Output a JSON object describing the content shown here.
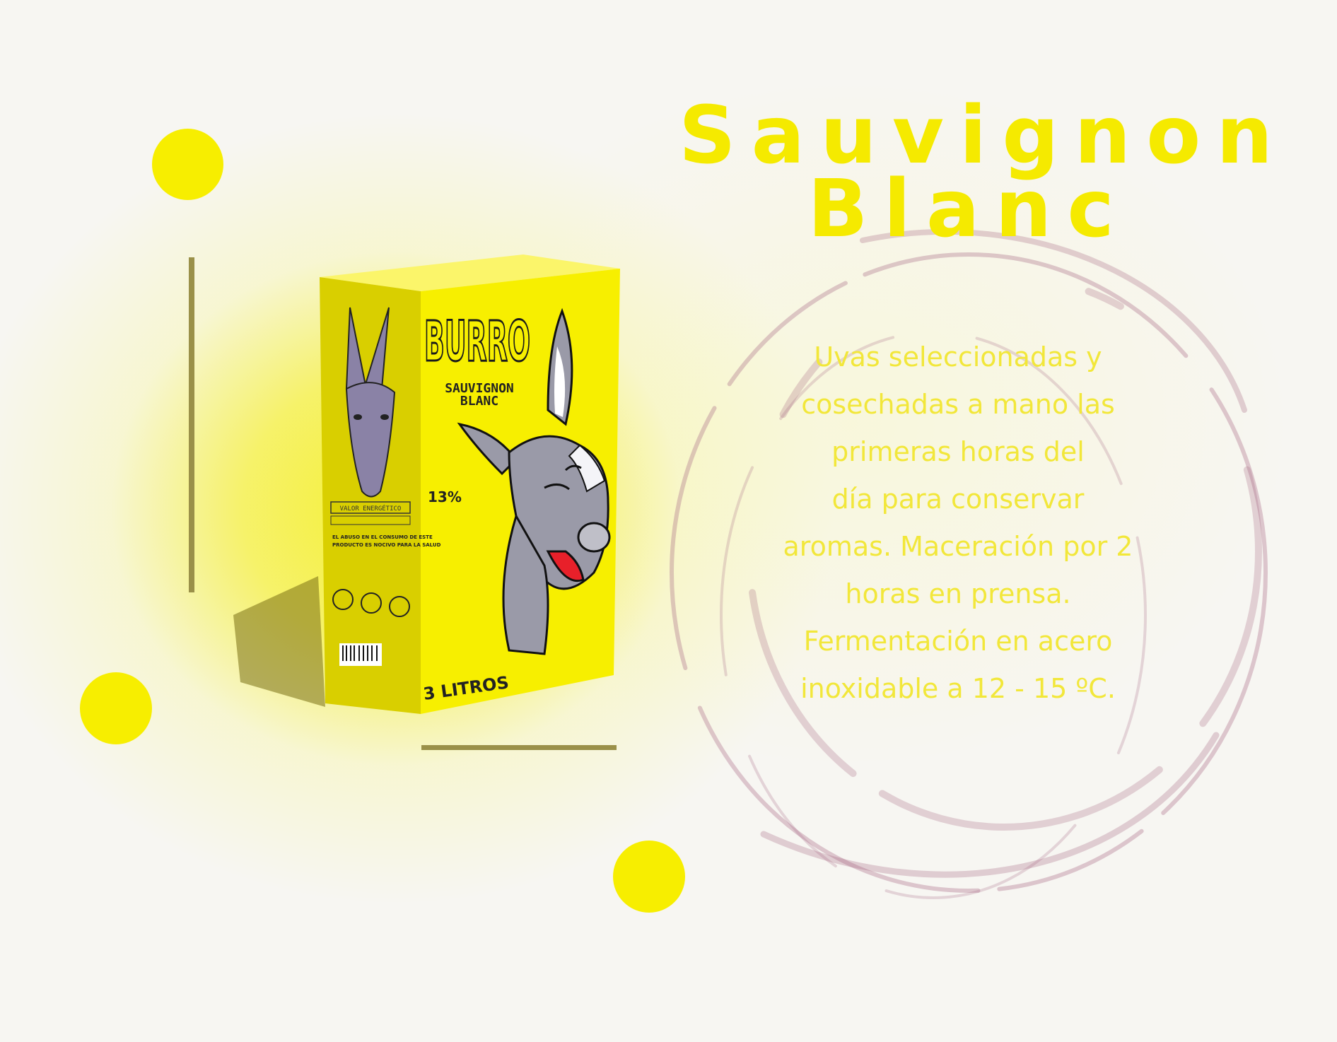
{
  "title_lines": [
    "Sauvignon",
    "Blanc"
  ],
  "description_lines": [
    "Uvas seleccionadas y",
    "cosechadas a mano las",
    "primeras horas del",
    "día para conservar",
    "aromas. Maceración por 2",
    "horas en prensa.",
    "Fermentación en acero",
    "inoxidable a 12 - 15 ºC."
  ],
  "product": {
    "brand": "BURRO",
    "variety_line1": "SAUVIGNON",
    "variety_line2": "BLANC",
    "abv": "13%",
    "volume": "3 LITROS",
    "side_panel_title": "VALOR ENERGÉTICO",
    "side_warning_line1": "EL ABUSO EN EL CONSUMO DE ESTE",
    "side_warning_line2": "PRODUCTO ES NOCIVO PARA LA SALUD"
  },
  "colors": {
    "accent_yellow": "#f5ea00",
    "box_yellow": "#f7ef00",
    "line_olive": "#9a9049",
    "wine_stain": "#a86a86",
    "donkey_grey": "#9a9aa8"
  }
}
